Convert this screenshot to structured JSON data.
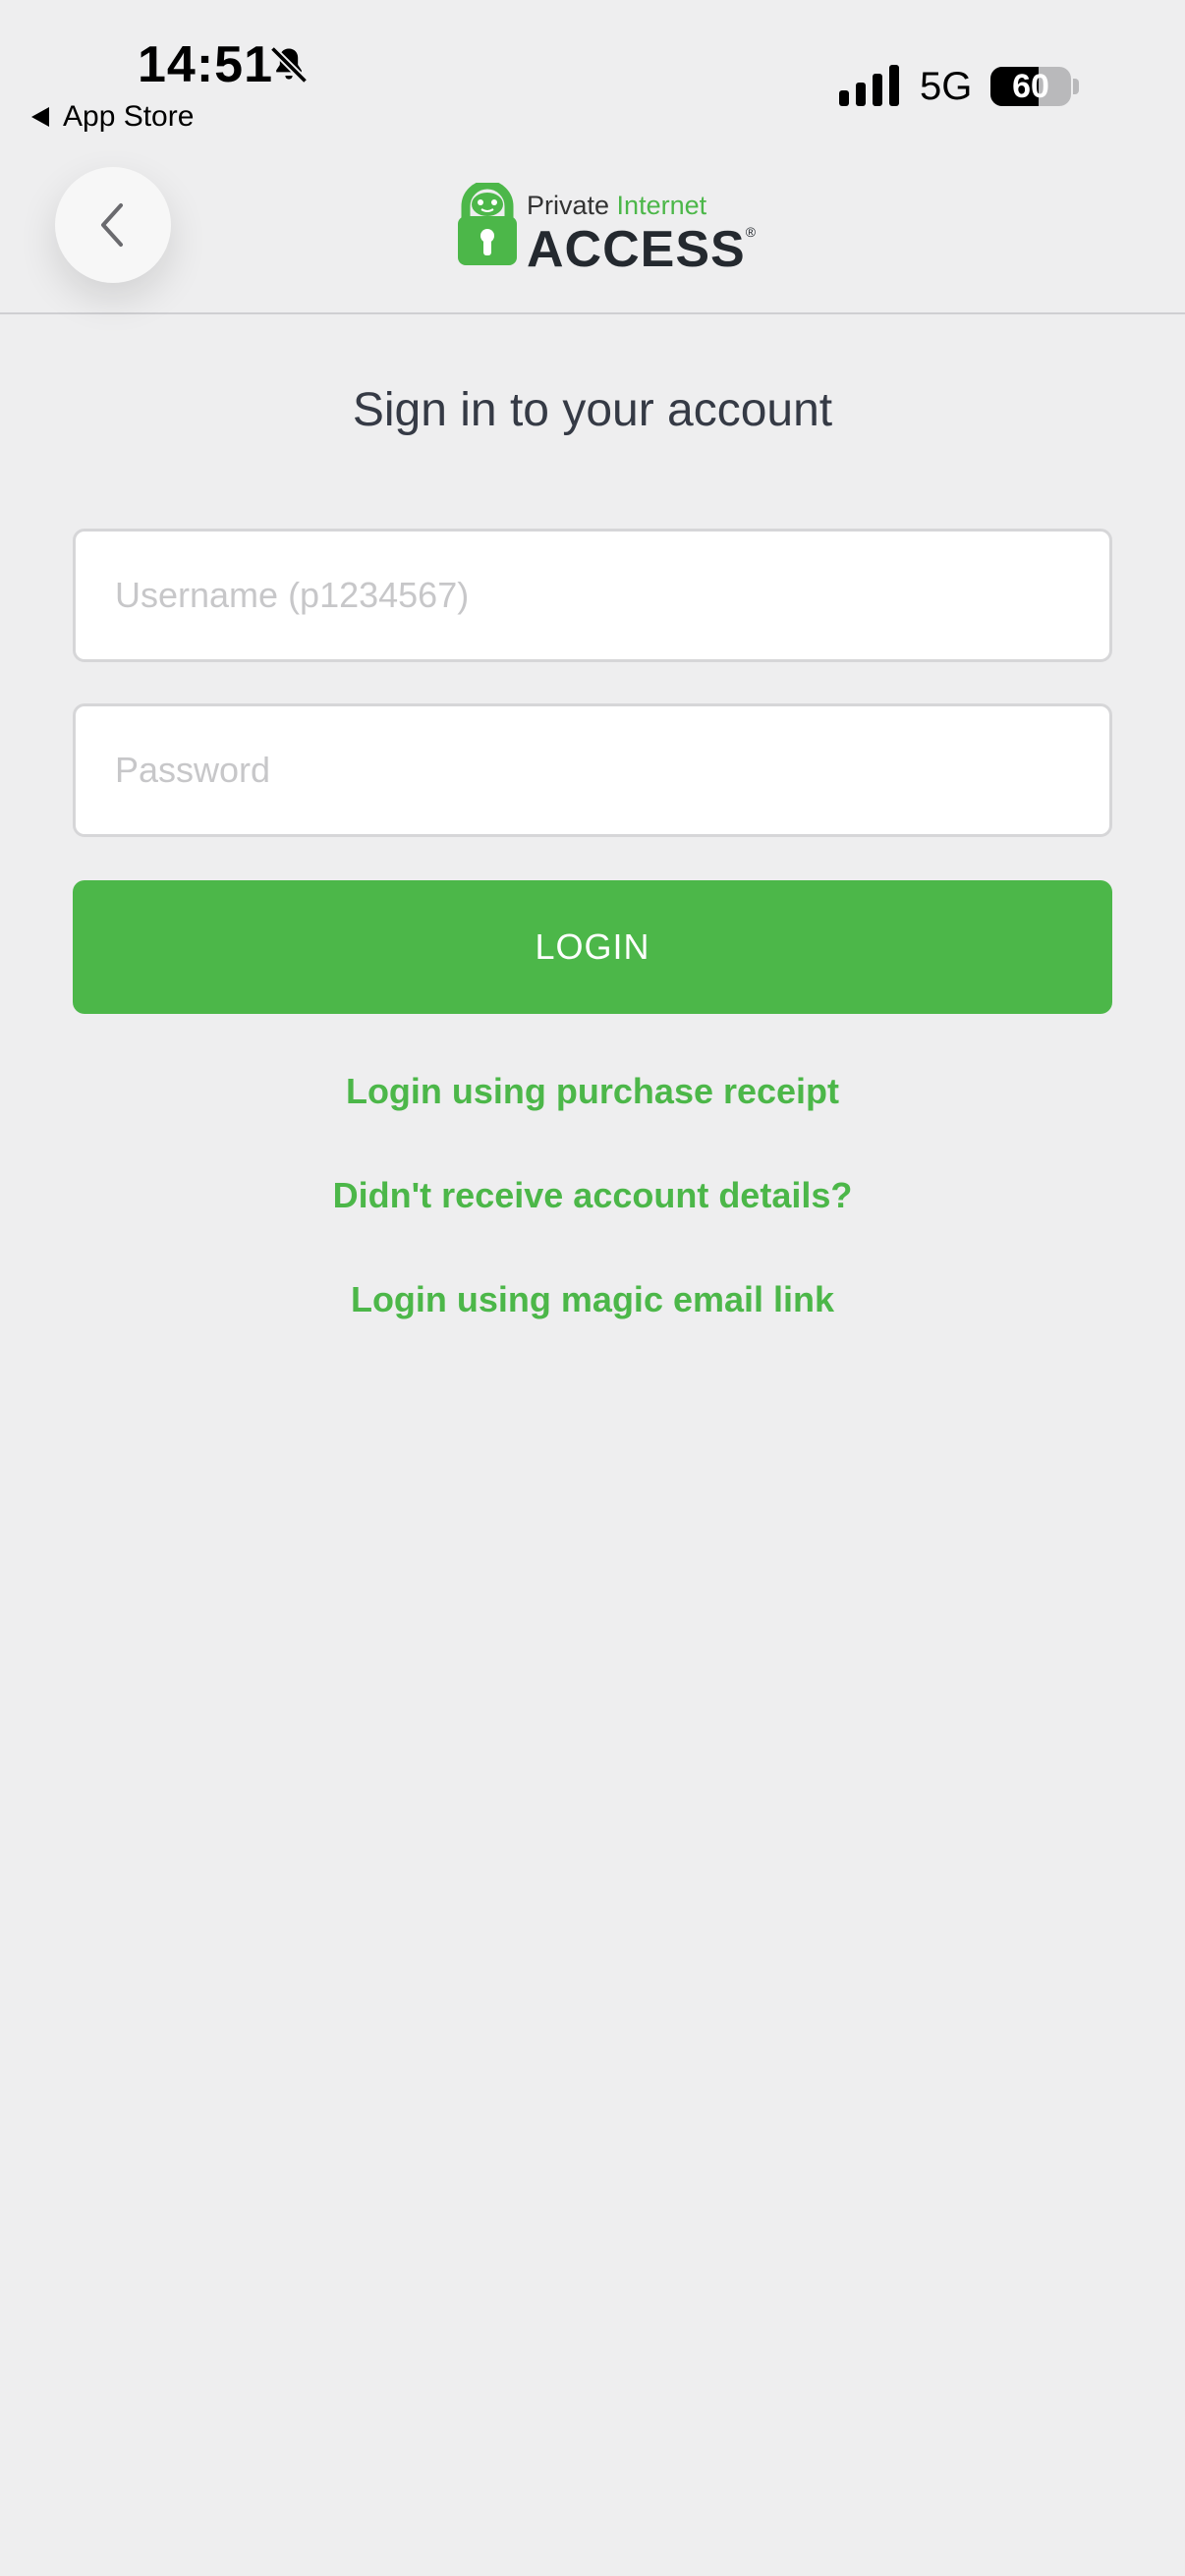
{
  "status_bar": {
    "time": "14:51",
    "back_app_label": "App Store",
    "network": "5G",
    "battery_percent": "60",
    "battery_level": 0.6
  },
  "header": {
    "logo_line1_a": "Private ",
    "logo_line1_b": "Internet",
    "logo_line2": "ACCESS",
    "logo_mark": "®"
  },
  "form": {
    "title": "Sign in to your account",
    "username_placeholder": "Username (p1234567)",
    "password_placeholder": "Password",
    "login_label": "LOGIN"
  },
  "links": {
    "purchase_receipt": "Login using purchase receipt",
    "account_details": "Didn't receive account details?",
    "magic_link": "Login using magic email link"
  },
  "colors": {
    "accent": "#4cb749",
    "background": "#eeeeef",
    "title_text": "#353a45"
  }
}
